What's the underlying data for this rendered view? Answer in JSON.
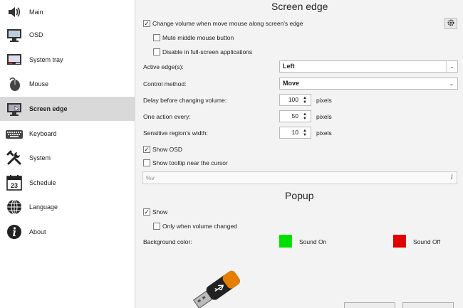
{
  "sidebar": {
    "items": [
      {
        "label": "Main",
        "icon": "speaker-icon"
      },
      {
        "label": "OSD",
        "icon": "monitor-icon"
      },
      {
        "label": "System tray",
        "icon": "system-tray-icon"
      },
      {
        "label": "Mouse",
        "icon": "mouse-icon"
      },
      {
        "label": "Screen edge",
        "icon": "screen-edge-icon"
      },
      {
        "label": "Keyboard",
        "icon": "keyboard-icon"
      },
      {
        "label": "System",
        "icon": "wrench-icon"
      },
      {
        "label": "Schedule",
        "icon": "calendar-icon"
      },
      {
        "label": "Language",
        "icon": "globe-icon"
      },
      {
        "label": "About",
        "icon": "info-icon"
      }
    ],
    "active": "Screen edge",
    "calendar_day": "23"
  },
  "screen_edge": {
    "title": "Screen edge",
    "change_volume_label": "Change volume when move mouse along screen's edge",
    "change_volume_checked": true,
    "mute_middle_label": "Mute middle mouse button",
    "mute_middle_checked": false,
    "disable_fullscreen_label": "Disable in full-screen applications",
    "disable_fullscreen_checked": false,
    "active_edges_label": "Active edge(s):",
    "active_edges_value": "Left",
    "control_method_label": "Control method:",
    "control_method_value": "Move",
    "delay_label": "Delay before changing volume:",
    "delay_value": "100",
    "delay_unit": "pixels",
    "action_label": "One action every:",
    "action_value": "50",
    "action_unit": "pixels",
    "sensitive_label": "Sensitive region's width:",
    "sensitive_value": "10",
    "sensitive_unit": "pixels",
    "show_osd_label": "Show OSD",
    "show_osd_checked": true,
    "show_tooltip_label": "Show tooltip near the cursor",
    "show_tooltip_checked": false,
    "tooltip_format_value": "%v"
  },
  "popup": {
    "title": "Popup",
    "show_label": "Show",
    "show_checked": true,
    "only_volume_label": "Only when volume changed",
    "only_volume_checked": false,
    "bg_color_label": "Background color:",
    "sound_on_label": "Sound On",
    "sound_on_color": "#00e000",
    "sound_off_label": "Sound Off",
    "sound_off_color": "#e00000"
  },
  "colors": {
    "active_item_bg": "#d9d9d9",
    "panel_bg": "#f3f3f3"
  }
}
